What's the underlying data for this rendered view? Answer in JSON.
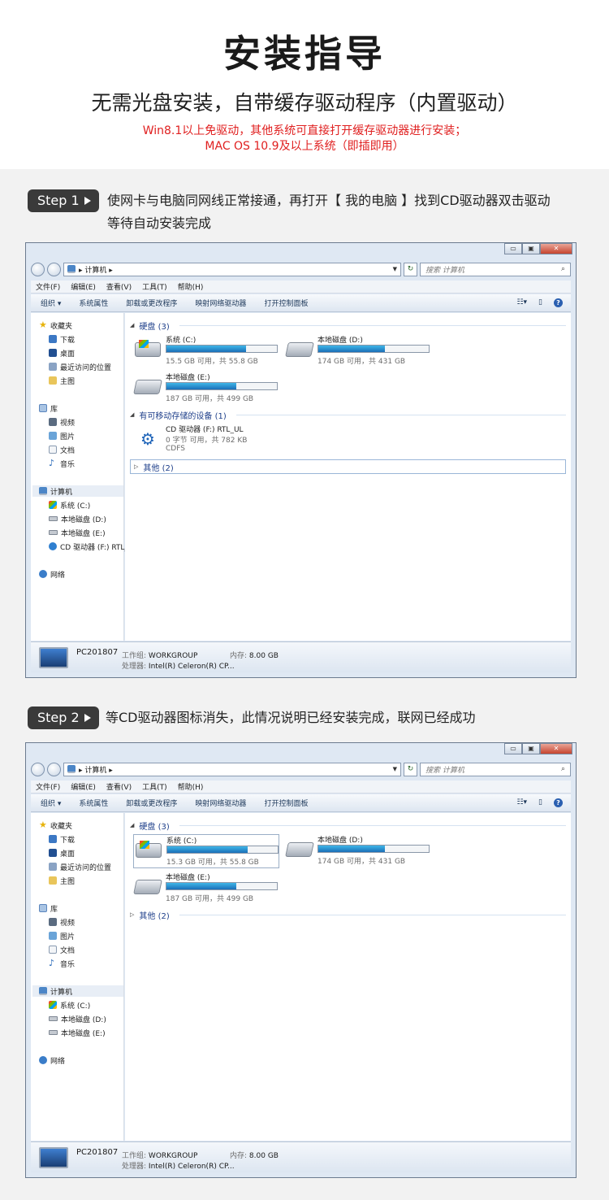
{
  "header": {
    "title": "安装指导",
    "subtitle": "无需光盘安装，自带缓存驱动程序（内置驱动）",
    "note_line1": "Win8.1以上免驱动，其他系统可直接打开缓存驱动器进行安装；",
    "note_line2": "MAC OS 10.9及以上系统（即插即用）"
  },
  "accent_colors": {
    "note_red": "#e02020",
    "badge_bg": "#3a3a3a"
  },
  "steps": [
    {
      "badge": "Step 1",
      "text_line1": "使网卡与电脑同网线正常接通，再打开【 我的电脑 】找到CD驱动器双击驱动",
      "text_line2": "等待自动安装完成"
    },
    {
      "badge": "Step 2",
      "text_line1": "等CD驱动器图标消失，此情况说明已经安装完成，联网已经成功",
      "text_line2": ""
    }
  ],
  "window": {
    "caption_min": "▭",
    "caption_max": "▣",
    "caption_close": "✕",
    "address": "▸ 计算机 ▸",
    "search_placeholder": "搜索 计算机",
    "menu": [
      "文件(F)",
      "编辑(E)",
      "查看(V)",
      "工具(T)",
      "帮助(H)"
    ],
    "commands": [
      "组织 ▾",
      "系统属性",
      "卸载或更改程序",
      "映射网络驱动器",
      "打开控制面板"
    ],
    "help": "?",
    "nav_favorites": "收藏夹",
    "nav_fav_items": [
      "下载",
      "桌面",
      "最近访问的位置",
      "主图"
    ],
    "nav_library": "库",
    "nav_lib_items": [
      "视频",
      "图片",
      "文档",
      "音乐"
    ],
    "nav_computer": "计算机",
    "nav_network": "网络",
    "group_hdd": "硬盘 (3)",
    "group_removable": "有可移动存储的设备 (1)",
    "group_other": "其他 (2)",
    "pc_name": "PC201807",
    "workgroup_label": "工作组:",
    "workgroup_value": "WORKGROUP",
    "memory_label": "内存:",
    "memory_value": "8.00 GB",
    "cpu_label": "处理器:",
    "cpu_value": "Intel(R) Celeron(R) CP..."
  },
  "window1": {
    "nav_drives": [
      "系统 (C:)",
      "本地磁盘 (D:)",
      "本地磁盘 (E:)",
      "CD 驱动器 (F:) RTL_"
    ],
    "drives": [
      {
        "name": "系统 (C:)",
        "info": "15.5 GB 可用，共 55.8 GB",
        "used_fraction": 0.72
      },
      {
        "name": "本地磁盘 (D:)",
        "info": "174 GB 可用，共 431 GB",
        "used_fraction": 0.6
      },
      {
        "name": "本地磁盘 (E:)",
        "info": "187 GB 可用，共 499 GB",
        "used_fraction": 0.63
      }
    ],
    "cd": {
      "name": "CD 驱动器 (F:) RTL_UL",
      "info": "0 字节 可用，共 782 KB",
      "fs": "CDFS"
    }
  },
  "window2": {
    "nav_drives": [
      "系统 (C:)",
      "本地磁盘 (D:)",
      "本地磁盘 (E:)"
    ],
    "drives": [
      {
        "name": "系统 (C:)",
        "info": "15.3 GB 可用，共 55.8 GB",
        "used_fraction": 0.73
      },
      {
        "name": "本地磁盘 (D:)",
        "info": "174 GB 可用，共 431 GB",
        "used_fraction": 0.6
      },
      {
        "name": "本地磁盘 (E:)",
        "info": "187 GB 可用，共 499 GB",
        "used_fraction": 0.63
      }
    ]
  }
}
